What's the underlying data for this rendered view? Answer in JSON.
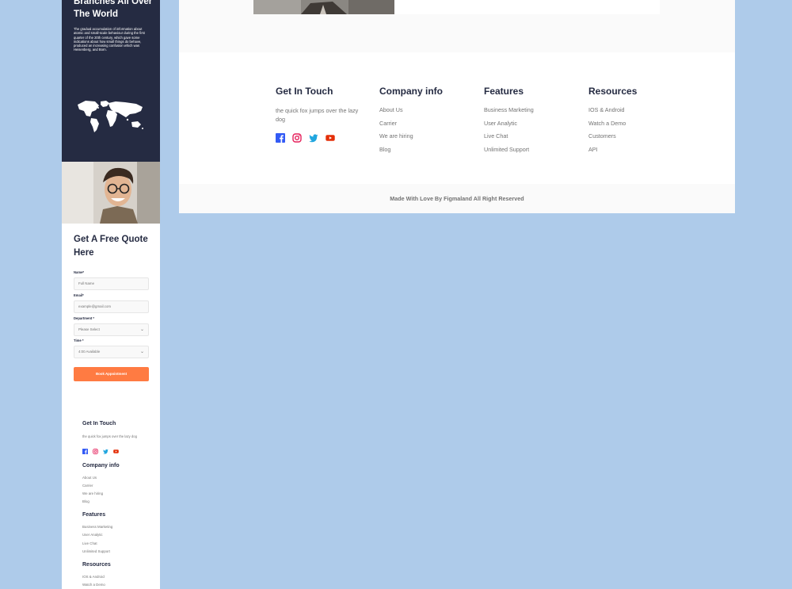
{
  "mobile": {
    "hero": {
      "title": "Branches All Over The World",
      "text": "The gradual accumulation of information about atomic and small-scale behaviour during the first quarter of the 20th century, which gave some indications about how small things do behave, produced an increasing confusion which was Heisenberg, and Born."
    },
    "quote": {
      "title": "Get A Free Quote Here",
      "name_label": "Name*",
      "name_placeholder": "Full Name",
      "email_label": "Email*",
      "email_placeholder": "example@gmail.com",
      "department_label": "Department *",
      "department_value": "Please Select",
      "time_label": "Time *",
      "time_value": "4:00 Available",
      "button": "Book Appointment"
    },
    "footer": {
      "touch_title": "Get In Touch",
      "touch_text": "the quick fox jumps over the lazy dog",
      "company_title": "Company info",
      "company_links": [
        "About Us",
        "Carrier",
        "We are hiring",
        "Blog"
      ],
      "features_title": "Features",
      "features_links": [
        "Business Marketing",
        "User Analytic",
        "Live Chat",
        "Unlimited Support"
      ],
      "resources_title": "Resources",
      "resources_links": [
        "IOS & Android",
        "Watch a Demo"
      ]
    }
  },
  "desktop": {
    "footer": {
      "touch_title": "Get In Touch",
      "touch_text": "the quick fox jumps over the lazy dog",
      "company_title": "Company info",
      "company_links": [
        "About Us",
        "Carrier",
        "We are hiring",
        "Blog"
      ],
      "features_title": "Features",
      "features_links": [
        "Business Marketing",
        "User Analytic",
        "Live Chat",
        "Unlimited Support"
      ],
      "resources_title": "Resources",
      "resources_links": [
        "IOS & Android",
        "Watch a Demo",
        "Customers",
        "API"
      ]
    },
    "copyright": "Made With Love By Figmaland All Right Reserved"
  },
  "social_icons": [
    "facebook-icon",
    "instagram-icon",
    "twitter-icon",
    "youtube-icon"
  ],
  "colors": {
    "background": "#aecbea",
    "navy": "#252b42",
    "accent": "#ff7b42",
    "muted": "#737373",
    "facebook": "#335bf5",
    "instagram": "#e51f5a",
    "twitter": "#21a6df",
    "youtube": "#e42f08"
  }
}
